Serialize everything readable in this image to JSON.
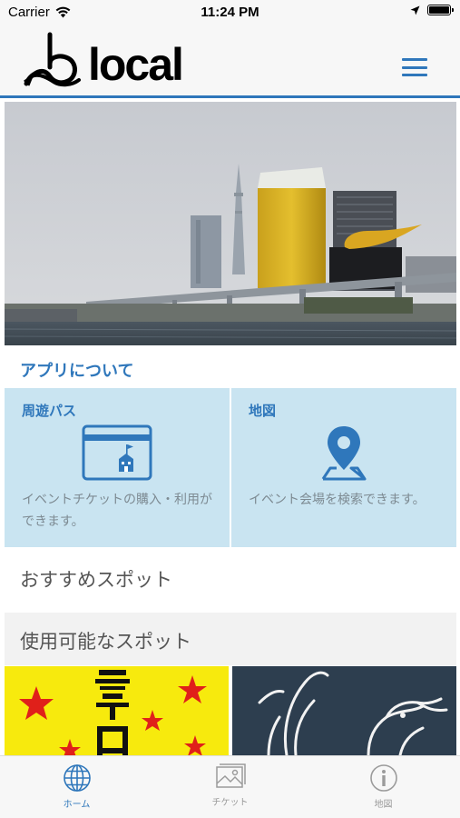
{
  "status_bar": {
    "carrier": "Carrier",
    "time": "11:24 PM"
  },
  "header": {
    "logo_text": "local",
    "menu_icon": "hamburger-menu-icon",
    "accent_color": "#2f77bb"
  },
  "hero": {
    "image": "tokyo-skyline-photo"
  },
  "about": {
    "title": "アプリについて"
  },
  "features": [
    {
      "title": "周遊パス",
      "icon": "ticket-pass-icon",
      "description": "イベントチケットの購入・利用ができます。"
    },
    {
      "title": "地図",
      "icon": "map-pin-icon",
      "description": "イベント会場を検索できます。"
    }
  ],
  "recommended": {
    "title": "おすすめスポット"
  },
  "available": {
    "title": "使用可能なスポット"
  },
  "tabbar": {
    "tabs": [
      {
        "label": "ホーム",
        "icon": "globe-icon",
        "active": true
      },
      {
        "label": "チケット",
        "icon": "image-icon",
        "active": false
      },
      {
        "label": "地図",
        "icon": "info-icon",
        "active": false
      }
    ]
  }
}
